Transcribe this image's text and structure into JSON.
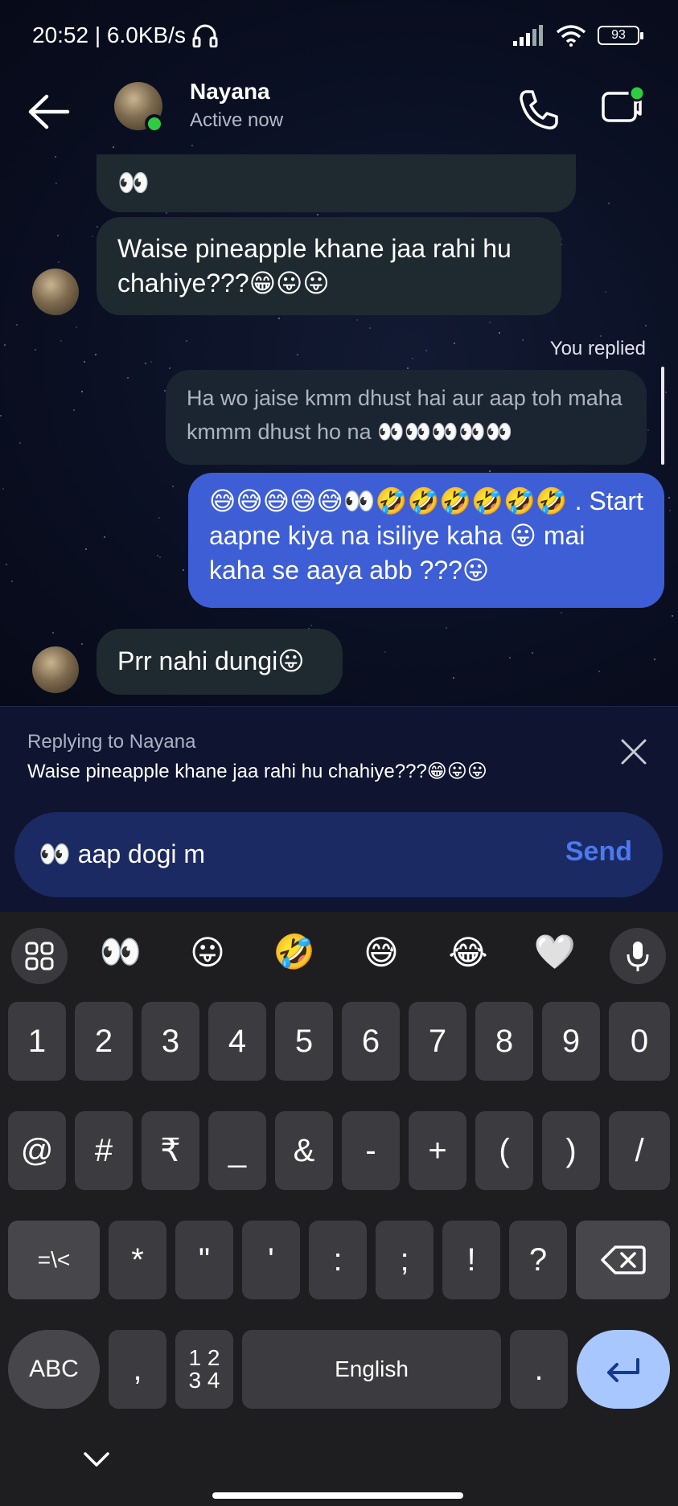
{
  "status_bar": {
    "time_speed": "20:52 | 6.0KB/s",
    "battery": "93"
  },
  "header": {
    "contact_name": "Nayana",
    "contact_status": "Active now"
  },
  "messages": {
    "cut_off_emoji": "👀",
    "incoming_1": "Waise pineapple khane jaa rahi hu chahiye???😁😛😛",
    "you_replied_label": "You replied",
    "reply_quote": "Ha wo jaise kmm dhust hai aur aap toh maha kmmm dhust ho na 👀👀👀👀👀",
    "outgoing_1": "😅😅😅😅😅👀🤣🤣🤣🤣🤣🤣 . Start aapne kiya na isiliye kaha 😛 mai kaha se aaya abb ???😛",
    "incoming_2": "Prr nahi dungi😛"
  },
  "reply_panel": {
    "title": "Replying to Nayana",
    "text": "Waise pineapple khane jaa rahi hu chahiye???😁😛😛"
  },
  "composer": {
    "value": "👀 aap dogi m",
    "send_label": "Send"
  },
  "keyboard": {
    "emoji_suggestions": [
      "👀",
      "😛",
      "🤣",
      "😅",
      "😂",
      "🤍"
    ],
    "row1": [
      "1",
      "2",
      "3",
      "4",
      "5",
      "6",
      "7",
      "8",
      "9",
      "0"
    ],
    "row2": [
      "@",
      "#",
      "₹",
      "_",
      "&",
      "-",
      "+",
      "(",
      ")",
      "/"
    ],
    "row3": [
      "=\\<",
      "*",
      "\"",
      "'",
      ":",
      ";",
      "!",
      "?"
    ],
    "row4": {
      "abc": "ABC",
      "comma": ",",
      "numpad": "1 2\n3 4",
      "space": "English",
      "period": "."
    }
  },
  "colors": {
    "outgoing_bubble": "#3e5ed6",
    "incoming_bubble": "#1f2a30",
    "send_text": "#4b79f0",
    "online": "#2ecc40"
  }
}
